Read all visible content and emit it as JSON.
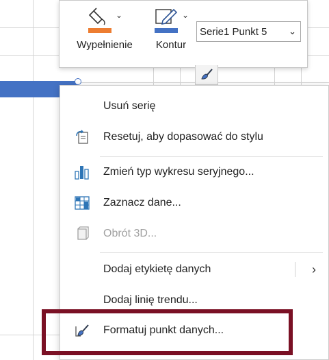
{
  "toolbar": {
    "fill_label": "Wypełnienie",
    "outline_label": "Kontur",
    "series_selector_value": "Serie1 Punkt 5",
    "fill_color": "#ed7d31",
    "outline_color": "#4472c4"
  },
  "series": {
    "bar_color": "#4472c4"
  },
  "context_menu": {
    "items": [
      {
        "label": "Usuń serię",
        "icon": "none"
      },
      {
        "label": "Resetuj, aby dopasować do stylu",
        "icon": "reset-style-icon"
      },
      {
        "label": "Zmień typ wykresu seryjnego...",
        "icon": "change-chart-type-icon"
      },
      {
        "label": "Zaznacz dane...",
        "icon": "select-data-icon"
      },
      {
        "label": "Obrót 3D...",
        "icon": "rotation-3d-icon",
        "disabled": true
      },
      {
        "label": "Dodaj etykietę danych",
        "icon": "none",
        "submenu": true
      },
      {
        "label": "Dodaj linię trendu...",
        "icon": "none"
      },
      {
        "label": "Formatuj punkt danych...",
        "icon": "format-data-point-icon",
        "highlighted": true
      }
    ]
  },
  "highlight_color": "#7a1024"
}
